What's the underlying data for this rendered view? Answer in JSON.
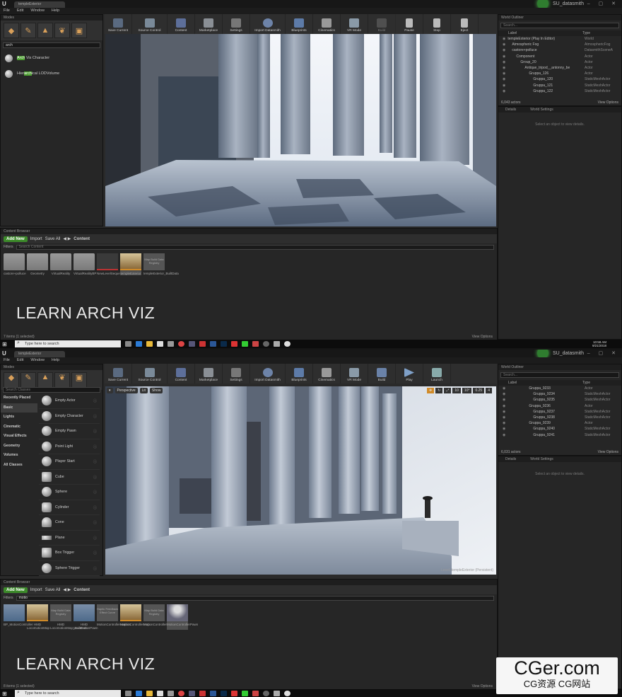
{
  "project_name": "SU_datasmith",
  "menu": [
    "File",
    "Edit",
    "Window",
    "Help"
  ],
  "toolbar1": [
    "Save Current",
    "Source Control",
    "Content",
    "Marketplace",
    "Settings",
    "Import Datasmith",
    "Blueprints",
    "Cinematics",
    "VR Mode",
    "Build",
    "Pause",
    "Stop",
    "Eject"
  ],
  "toolbar2": [
    "Save Current",
    "Source Control",
    "Content",
    "Marketplace",
    "Settings",
    "Import Datasmith",
    "Blueprints",
    "Cinematics",
    "VR Mode",
    "Build",
    "Play",
    "Launch"
  ],
  "top": {
    "modes_tab": "Modes",
    "search_value": "arch",
    "results": [
      {
        "pre": "",
        "hl": "Arch",
        "post": " Vis Character"
      },
      {
        "pre": "Hier",
        "hl": "arch",
        "post": "ical LODVolume"
      }
    ],
    "outliner": {
      "tab": "World Outliner",
      "search_placeholder": "Search...",
      "col_label": "Label",
      "col_type": "Type",
      "rows": [
        {
          "name": "templeExterior (Play In Editor)",
          "type": "World"
        },
        {
          "name": "Atmospheric Fog",
          "type": "AtmosphericFog"
        },
        {
          "name": "castore+polluce",
          "type": "DatasmithSceneA"
        },
        {
          "name": "Component",
          "type": "Actor"
        },
        {
          "name": "Group_20",
          "type": "Actor"
        },
        {
          "name": "Antique_tripod__antonny_be",
          "type": "Actor"
        },
        {
          "name": "Gruppa_126",
          "type": "Actor"
        },
        {
          "name": "Gruppa_120",
          "type": "StaticMeshActor"
        },
        {
          "name": "Gruppa_121",
          "type": "StaticMeshActor"
        },
        {
          "name": "Gruppa_122",
          "type": "StaticMeshActor"
        }
      ],
      "count": "6,043 actors",
      "view_options": "View Options"
    },
    "details_tab": "Details",
    "world_settings_tab": "World Settings",
    "details_msg": "Select an object to view details.",
    "cb_tab": "Content Browser",
    "add_new": "Add New",
    "import": "Import",
    "save_all": "Save All",
    "path": "Content",
    "filters": "Filters",
    "search_ph": "Search Content",
    "assets": [
      {
        "kind": "folder",
        "label": "castore+polluce"
      },
      {
        "kind": "folder",
        "label": "Geometry"
      },
      {
        "kind": "folder",
        "label": "VirtualReality"
      },
      {
        "kind": "folder",
        "label": "VirtualRealityBP"
      },
      {
        "kind": "seq",
        "label": "NewLevelSequence"
      },
      {
        "kind": "level",
        "label": "templeExterior"
      },
      {
        "kind": "data",
        "label": "templeExterior_BuiltData",
        "thumb": "Map Build Data Registry"
      }
    ],
    "learn": "LEARN ARCH VIZ",
    "status": "7 items (1 selected)",
    "view_options": "View Options",
    "clock_time": "10:58 AM",
    "clock_date": "9/21/2018"
  },
  "bottom": {
    "modes_tab": "Modes",
    "search_ph": "Search Classes",
    "categories": [
      "Recently Placed",
      "Basic",
      "Lights",
      "Cinematic",
      "Visual Effects",
      "Geometry",
      "Volumes",
      "All Classes"
    ],
    "items": [
      "Empty Actor",
      "Empty Character",
      "Empty Pawn",
      "Point Light",
      "Player Start",
      "Cube",
      "Sphere",
      "Cylinder",
      "Cone",
      "Plane",
      "Box Trigger",
      "Sphere Trigger"
    ],
    "vp_buttons": [
      "Perspective",
      "Lit",
      "Show"
    ],
    "vp_right": [
      "10",
      "10°",
      "0.25",
      "4"
    ],
    "level": "Level: templeExterior (Persistent)",
    "outliner": {
      "tab": "World Outliner",
      "search_placeholder": "Search...",
      "col_label": "Label",
      "col_type": "Type",
      "rows": [
        {
          "name": "Gruppa_9233",
          "type": "Actor"
        },
        {
          "name": "Gruppa_9234",
          "type": "StaticMeshActor"
        },
        {
          "name": "Gruppa_9235",
          "type": "StaticMeshActor"
        },
        {
          "name": "Gruppa_9236",
          "type": "Actor"
        },
        {
          "name": "Gruppa_9237",
          "type": "StaticMeshActor"
        },
        {
          "name": "Gruppa_9238",
          "type": "StaticMeshActor"
        },
        {
          "name": "Gruppa_9239",
          "type": "Actor"
        },
        {
          "name": "Gruppa_9240",
          "type": "StaticMeshActor"
        },
        {
          "name": "Gruppa_9241",
          "type": "StaticMeshActor"
        }
      ],
      "count": "6,031 actors",
      "view_options": "View Options"
    },
    "details_tab": "Details",
    "world_settings_tab": "World Settings",
    "details_msg": "Select an object to view details.",
    "cb_tab": "Content Browser",
    "add_new": "Add New",
    "import": "Import",
    "save_all": "Save All",
    "path": "Content",
    "filters": "Filters",
    "search_value": "motio",
    "assets": [
      {
        "kind": "bp",
        "label": "BP_MotionController"
      },
      {
        "kind": "level",
        "label": "HMD LocomotionMap"
      },
      {
        "kind": "data",
        "label": "HMD LocomotionMap_BuiltData",
        "thumb": "Map Build Data Registry"
      },
      {
        "kind": "bp",
        "label": "HMD LocomotionPawn"
      },
      {
        "kind": "data",
        "label": "MotionControllerHaptics",
        "thumb": "Haptic Feedback Effect Curve"
      },
      {
        "kind": "level",
        "label": "MotionControllerMap"
      },
      {
        "kind": "data",
        "label": "MotionControllerMap_BuiltData",
        "thumb": "Map Build Data Registry"
      },
      {
        "kind": "pawn",
        "label": "MotionControllerPawn"
      }
    ],
    "learn": "LEARN ARCH VIZ",
    "status": "8 items (1 selected)",
    "view_options": "View Options"
  },
  "taskbar_search": "Type here to search",
  "watermark_big": "CGer.com",
  "watermark_small": "CG资源 CG网站"
}
